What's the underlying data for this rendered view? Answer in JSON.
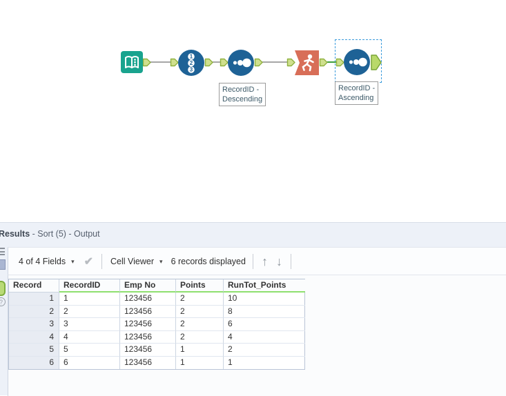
{
  "workflow": {
    "tools": [
      {
        "name": "Input Data",
        "icon": "book-icon"
      },
      {
        "name": "RecordID",
        "icon": "numbered-list-icon",
        "digits": [
          "1",
          "2",
          "3"
        ]
      },
      {
        "name": "Sort",
        "icon": "sort-dots-icon",
        "annotation": [
          "RecordID -",
          "Descending"
        ]
      },
      {
        "name": "Running Total",
        "icon": "runner-icon"
      },
      {
        "name": "Sort",
        "icon": "sort-dots-icon",
        "annotation": [
          "RecordID -",
          "Ascending"
        ],
        "selected": true
      }
    ],
    "colors": {
      "tool_teal": "#19A38E",
      "tool_blue": "#1E6296",
      "tool_orange": "#D86E58",
      "anchor_fill": "#cfe08e",
      "anchor_border": "#8fb13f",
      "connection_gray": "#a6a6a6",
      "connection_green": "#3C9E3C",
      "selection_blue": "#3A9BDC"
    }
  },
  "results": {
    "title": {
      "bold": "Results",
      "rest": " - Sort (5) - Output"
    },
    "toolbar": {
      "fields": "4 of 4 Fields",
      "cell_viewer": "Cell Viewer",
      "records": "6 records displayed"
    },
    "icons": {
      "caret": "▾",
      "check": "✔",
      "arrow_up": "↑",
      "arrow_down": "↓",
      "help": "?"
    },
    "table": {
      "columns": [
        "Record",
        "RecordID",
        "Emp No",
        "Points",
        "RunTot_Points"
      ],
      "header_underline_color": "#8ee06e",
      "rows": [
        [
          "1",
          "1",
          "123456",
          "2",
          "10"
        ],
        [
          "2",
          "2",
          "123456",
          "2",
          "8"
        ],
        [
          "3",
          "3",
          "123456",
          "2",
          "6"
        ],
        [
          "4",
          "4",
          "123456",
          "2",
          "4"
        ],
        [
          "5",
          "5",
          "123456",
          "1",
          "2"
        ],
        [
          "6",
          "6",
          "123456",
          "1",
          "1"
        ]
      ]
    }
  }
}
